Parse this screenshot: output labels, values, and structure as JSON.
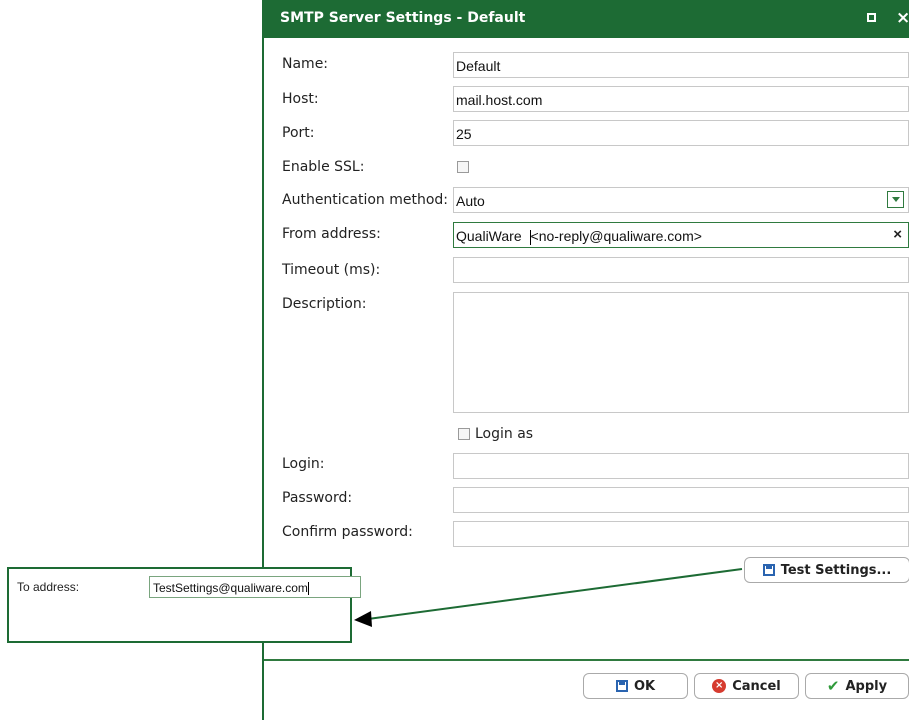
{
  "dialog": {
    "title": "SMTP Server Settings - Default",
    "controls": {
      "maximize_icon": "maximize-icon",
      "close_icon": "close-icon",
      "close_glyph": "×"
    }
  },
  "form": {
    "name": {
      "label": "Name:",
      "value": "Default"
    },
    "host": {
      "label": "Host:",
      "value": "mail.host.com"
    },
    "port": {
      "label": "Port:",
      "value": "25"
    },
    "enable_ssl": {
      "label": "Enable SSL:",
      "checked": false
    },
    "auth_method": {
      "label": "Authentication method:",
      "value": "Auto"
    },
    "from_address": {
      "label": "From address:",
      "value_part1": "QualiWare",
      "value_part2": "<no-reply@qualiware.com>",
      "clear_glyph": "×"
    },
    "timeout": {
      "label": "Timeout (ms):",
      "value": ""
    },
    "description": {
      "label": "Description:",
      "value": ""
    },
    "login_as": {
      "label": "Login as",
      "checked": false
    },
    "login": {
      "label": "Login:",
      "value": ""
    },
    "password": {
      "label": "Password:",
      "value": ""
    },
    "confirm_password": {
      "label": "Confirm password:",
      "value": ""
    }
  },
  "buttons": {
    "test_settings": "Test Settings...",
    "ok": "OK",
    "cancel": "Cancel",
    "apply": "Apply"
  },
  "popup": {
    "to_address_label": "To address:",
    "to_address_value": "TestSettings@qualiware.com"
  },
  "colors": {
    "accent": "#1d6b34",
    "arrow": "#1d6b34"
  }
}
